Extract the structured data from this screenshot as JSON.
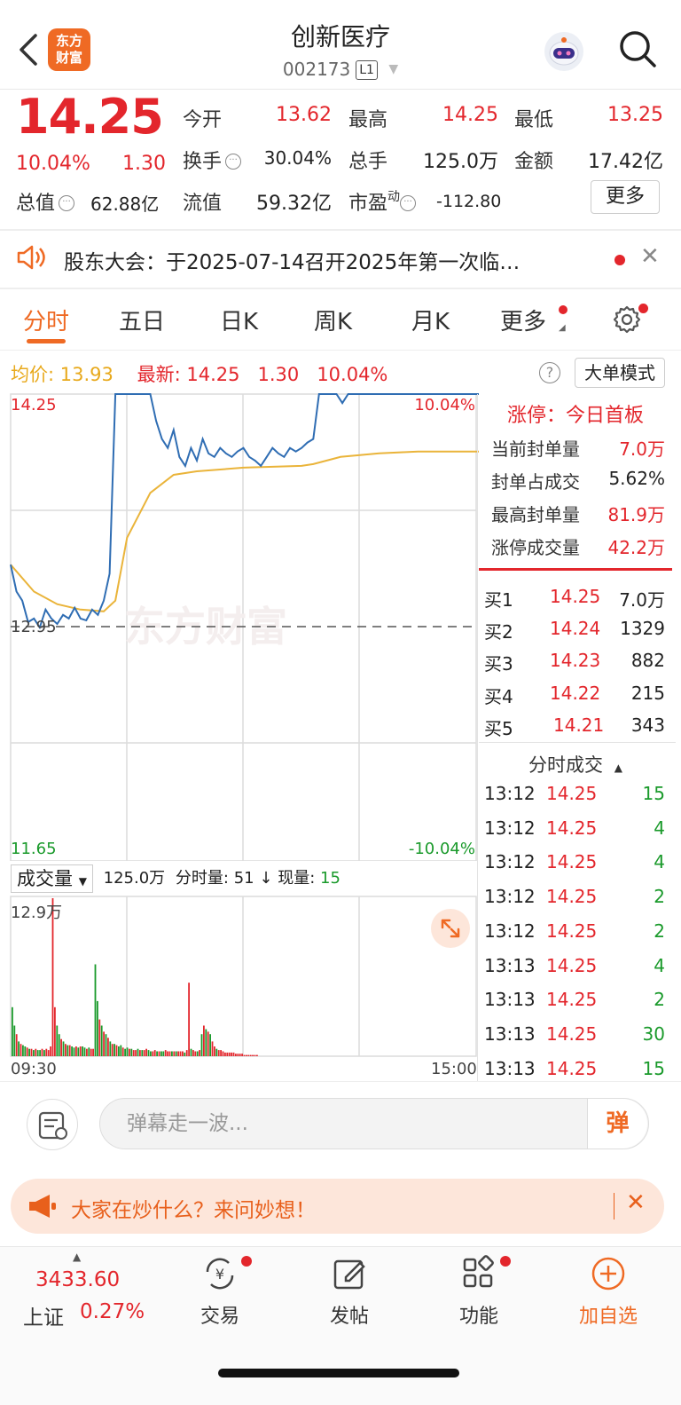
{
  "header": {
    "logo_text_1": "东方",
    "logo_text_2": "财富",
    "stock_name": "创新医疗",
    "stock_code": "002173",
    "level_badge": "L1"
  },
  "quote": {
    "price": "14.25",
    "change_pct": "10.04%",
    "change_amt": "1.30",
    "open_label": "今开",
    "open": "13.62",
    "high_label": "最高",
    "high": "14.25",
    "low_label": "最低",
    "low": "13.25",
    "turnover_label": "换手",
    "turnover": "30.04%",
    "volume_label": "总手",
    "volume": "125.0万",
    "amount_label": "金额",
    "amount": "17.42亿",
    "mktcap_label": "总值",
    "mktcap": "62.88亿",
    "float_label": "流值",
    "float": "59.32亿",
    "pe_label": "市盈",
    "pe_sup": "动",
    "pe": "-112.80",
    "more_label": "更多"
  },
  "notice": {
    "text": "股东大会：于2025-07-14召开2025年第一次临…"
  },
  "tabs": [
    "分时",
    "五日",
    "日K",
    "周K",
    "月K",
    "更多"
  ],
  "intraday": {
    "avg_label": "均价:",
    "avg_price": "13.93",
    "latest_label": "最新:",
    "latest_price": "14.25",
    "latest_change": "1.30",
    "latest_pct": "10.04%",
    "mode_button": "大单模式",
    "price_top": "14.25",
    "price_mid": "12.95",
    "price_bottom": "11.65",
    "pct_top": "10.04%",
    "pct_bottom": "-10.04%",
    "watermark": "东方财富",
    "time_start": "09:30",
    "time_end": "15:00"
  },
  "volume": {
    "selector": "成交量",
    "total": "125.0万",
    "minute_label": "分时量:",
    "minute_value": "51",
    "current_label": "现量:",
    "current_value": "15",
    "max_label": "12.9万"
  },
  "limit_panel": {
    "title": "涨停：今日首板",
    "rows": [
      {
        "label": "当前封单量",
        "value": "7.0万"
      },
      {
        "label": "封单占成交",
        "value": "5.62%"
      },
      {
        "label": "最高封单量",
        "value": "81.9万"
      },
      {
        "label": "涨停成交量",
        "value": "42.2万"
      }
    ]
  },
  "order_book": [
    {
      "label": "买1",
      "price": "14.25",
      "qty": "7.0万"
    },
    {
      "label": "买2",
      "price": "14.24",
      "qty": "1329"
    },
    {
      "label": "买3",
      "price": "14.23",
      "qty": "882"
    },
    {
      "label": "买4",
      "price": "14.22",
      "qty": "215"
    },
    {
      "label": "买5",
      "price": "14.21",
      "qty": "343"
    }
  ],
  "ticks": {
    "header": "分时成交",
    "rows": [
      {
        "time": "13:12",
        "price": "14.25",
        "qty": "15"
      },
      {
        "time": "13:12",
        "price": "14.25",
        "qty": "4"
      },
      {
        "time": "13:12",
        "price": "14.25",
        "qty": "4"
      },
      {
        "time": "13:12",
        "price": "14.25",
        "qty": "2"
      },
      {
        "time": "13:12",
        "price": "14.25",
        "qty": "2"
      },
      {
        "time": "13:13",
        "price": "14.25",
        "qty": "4"
      },
      {
        "time": "13:13",
        "price": "14.25",
        "qty": "2"
      },
      {
        "time": "13:13",
        "price": "14.25",
        "qty": "30"
      },
      {
        "time": "13:13",
        "price": "14.25",
        "qty": "15"
      }
    ]
  },
  "danmu": {
    "placeholder": "弹幕走一波...",
    "send_label": "弹"
  },
  "banner": {
    "text": "大家在炒什么？来问妙想！"
  },
  "bottom_nav": {
    "index_value": "3433.60",
    "index_name": "上证",
    "index_pct": "0.27%",
    "items": [
      "交易",
      "发帖",
      "功能",
      "加自选"
    ]
  },
  "colors": {
    "up": "#e3262c",
    "down": "#1a9a2b",
    "brand": "#ef6a24",
    "price_line": "#2f6db3",
    "avg_line": "#eab43a"
  },
  "chart_data": {
    "type": "line",
    "x_range": [
      "09:30",
      "15:00"
    ],
    "ylim": [
      11.65,
      14.25
    ],
    "reference_price": 12.95,
    "series": [
      {
        "name": "price",
        "x_minutes": [
          0,
          3,
          6,
          9,
          12,
          15,
          18,
          21,
          24,
          27,
          30,
          33,
          36,
          39,
          42,
          45,
          48,
          51,
          54,
          57,
          60,
          63,
          66,
          69,
          72,
          75,
          78,
          81,
          84,
          87,
          90,
          93,
          96,
          99,
          102,
          105,
          108,
          111,
          114,
          117,
          120,
          123,
          126,
          129,
          132,
          135,
          138,
          141,
          144,
          147,
          150,
          153,
          156,
          159,
          162,
          165,
          168,
          171,
          174,
          177,
          180,
          183,
          186,
          189,
          192,
          195,
          198,
          201,
          204,
          207,
          210,
          213,
          216,
          219,
          222,
          225,
          228,
          231,
          234,
          237,
          240,
          243
        ],
        "values": [
          13.3,
          13.15,
          13.1,
          12.98,
          13.0,
          12.95,
          13.05,
          13.0,
          12.97,
          13.02,
          13.0,
          13.06,
          13.0,
          12.99,
          13.05,
          13.02,
          13.1,
          13.25,
          14.25,
          14.25,
          14.25,
          14.25,
          14.25,
          14.25,
          14.25,
          14.1,
          14.0,
          13.95,
          14.05,
          13.9,
          13.85,
          13.95,
          13.88,
          14.0,
          13.92,
          13.9,
          13.95,
          13.92,
          13.9,
          13.93,
          13.95,
          13.9,
          13.88,
          13.85,
          13.9,
          13.95,
          13.92,
          13.9,
          13.95,
          13.93,
          13.95,
          13.98,
          14.0,
          14.25,
          14.25,
          14.25,
          14.25,
          14.2,
          14.25,
          14.25,
          14.25,
          14.25,
          14.25,
          14.25,
          14.25,
          14.25,
          14.25,
          14.25,
          14.25,
          14.25,
          14.25,
          14.25,
          14.25,
          14.25,
          14.25,
          14.25,
          14.25,
          14.25,
          14.25,
          14.25,
          14.25,
          14.25
        ]
      },
      {
        "name": "avg",
        "x_minutes": [
          0,
          12,
          24,
          36,
          48,
          54,
          60,
          72,
          84,
          96,
          108,
          120,
          150,
          156,
          170,
          190,
          210,
          243
        ],
        "values": [
          13.3,
          13.15,
          13.08,
          13.05,
          13.04,
          13.1,
          13.45,
          13.7,
          13.8,
          13.82,
          13.83,
          13.84,
          13.85,
          13.86,
          13.9,
          13.92,
          13.93,
          13.93
        ]
      }
    ],
    "volume": {
      "ylim": [
        0,
        129000
      ],
      "values": [
        40,
        25,
        18,
        12,
        10,
        9,
        8,
        7,
        6,
        6,
        5,
        6,
        5,
        5,
        6,
        5,
        6,
        5,
        8,
        129,
        40,
        25,
        18,
        14,
        12,
        10,
        9,
        9,
        8,
        7,
        8,
        7,
        8,
        8,
        7,
        6,
        7,
        6,
        6,
        75,
        45,
        30,
        25,
        20,
        18,
        15,
        12,
        10,
        10,
        9,
        8,
        9,
        7,
        6,
        7,
        6,
        6,
        5,
        5,
        6,
        5,
        5,
        5,
        6,
        5,
        4,
        4,
        5,
        4,
        4,
        4,
        4,
        5,
        4,
        4,
        4,
        4,
        4,
        4,
        4,
        4,
        3,
        5,
        60,
        6,
        5,
        4,
        4,
        5,
        18,
        25,
        22,
        20,
        18,
        12,
        8,
        6,
        5,
        5,
        4,
        3,
        3,
        3,
        3,
        3,
        2,
        2,
        2,
        2,
        1,
        1,
        1,
        1,
        1,
        1,
        1
      ],
      "colors": [
        "g",
        "g",
        "r",
        "g",
        "r",
        "g",
        "g",
        "r",
        "g",
        "r",
        "g",
        "r",
        "g",
        "g",
        "r",
        "g",
        "r",
        "r",
        "r",
        "r",
        "r",
        "g",
        "g",
        "r",
        "g",
        "r",
        "g",
        "r",
        "g",
        "g",
        "r",
        "g",
        "r",
        "g",
        "g",
        "r",
        "g",
        "r",
        "r",
        "g",
        "g",
        "r",
        "g",
        "r",
        "g",
        "r",
        "g",
        "r",
        "g",
        "r",
        "g",
        "g",
        "r",
        "g",
        "g",
        "r",
        "g",
        "r",
        "r",
        "g",
        "r",
        "g",
        "r",
        "r",
        "g",
        "g",
        "r",
        "r",
        "g",
        "r",
        "g",
        "g",
        "r",
        "r",
        "r",
        "g",
        "r",
        "g",
        "r",
        "r",
        "r",
        "g",
        "r",
        "r",
        "g",
        "r",
        "r",
        "g",
        "r",
        "g",
        "r",
        "g",
        "r",
        "g",
        "r",
        "r",
        "g",
        "r",
        "r",
        "r",
        "r",
        "r",
        "r",
        "r",
        "r",
        "r",
        "r",
        "r",
        "r",
        "r",
        "r"
      ]
    }
  }
}
